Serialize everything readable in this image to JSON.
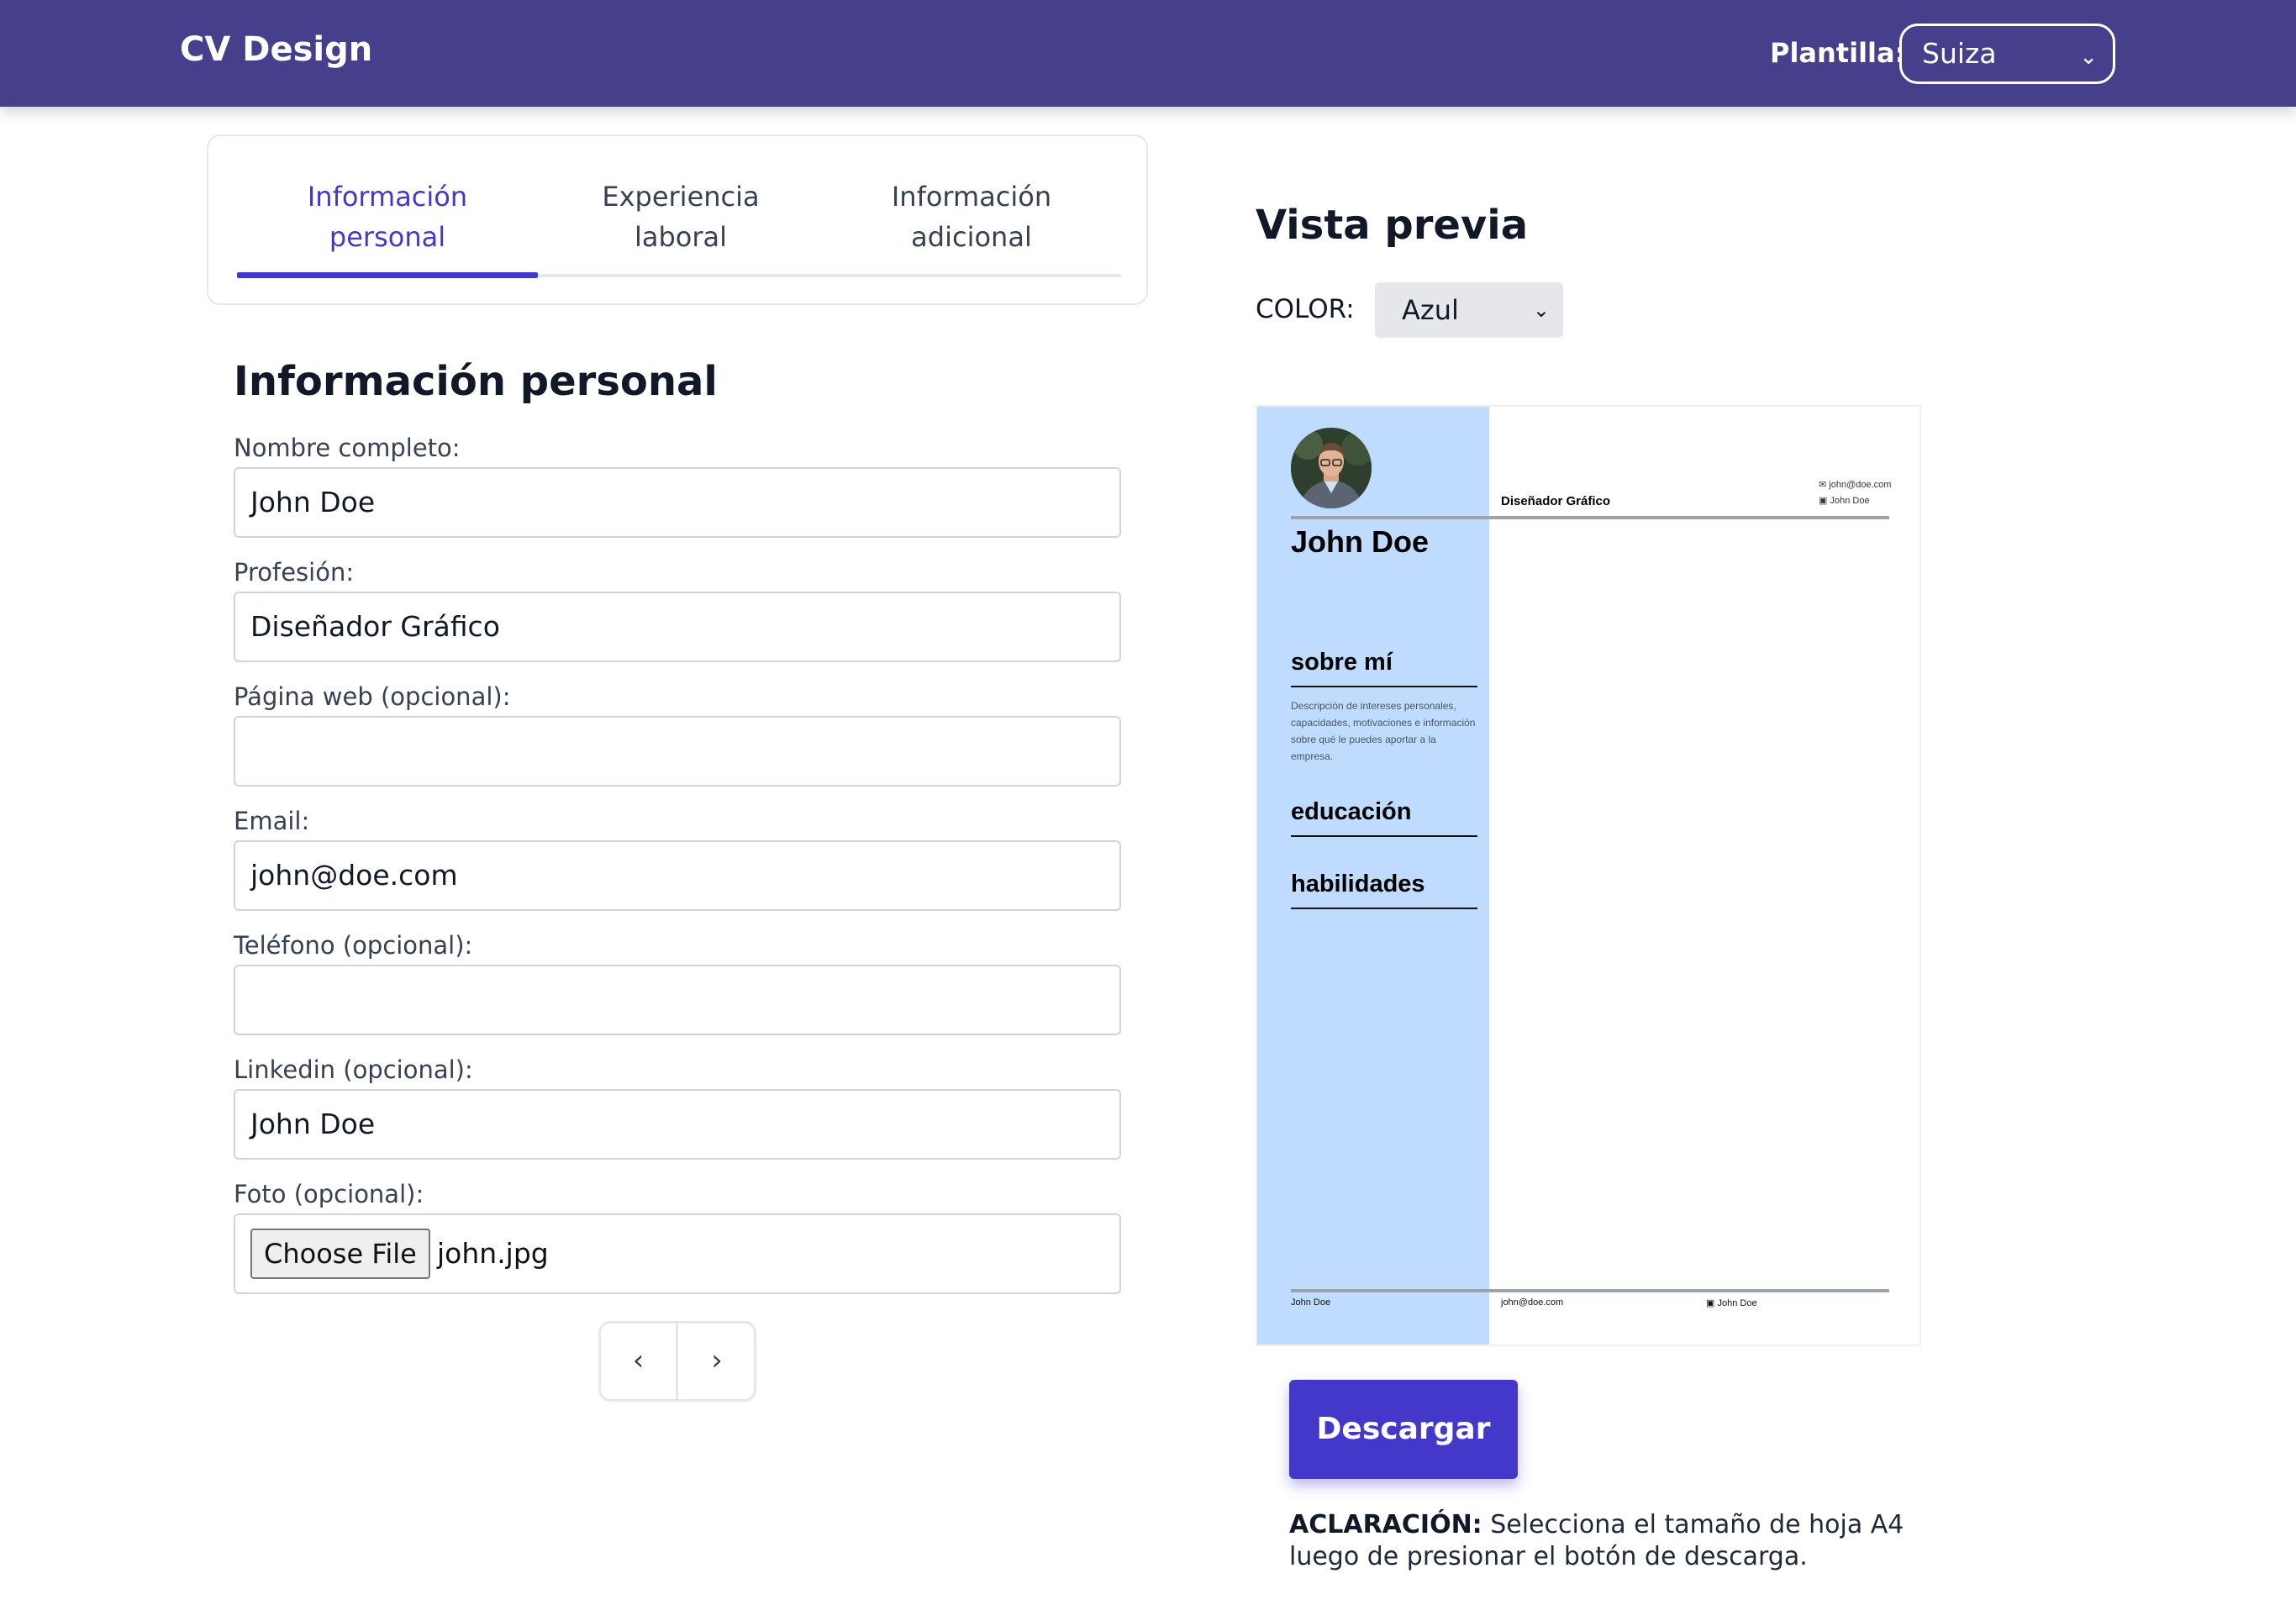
{
  "header": {
    "brand": "CV Design",
    "template_label": "Plantilla:",
    "template_value": "Suiza"
  },
  "tabs": [
    {
      "line1": "Información",
      "line2": "personal",
      "active": true
    },
    {
      "line1": "Experiencia",
      "line2": "laboral",
      "active": false
    },
    {
      "line1": "Información",
      "line2": "adicional",
      "active": false
    }
  ],
  "form": {
    "title": "Información personal",
    "fields": {
      "name": {
        "label": "Nombre completo:",
        "value": "John Doe"
      },
      "profession": {
        "label": "Profesión:",
        "value": "Diseñador Gráfico"
      },
      "website": {
        "label": "Página web (opcional):",
        "value": ""
      },
      "email": {
        "label": "Email:",
        "value": "john@doe.com"
      },
      "phone": {
        "label": "Teléfono (opcional):",
        "value": ""
      },
      "linkedin": {
        "label": "Linkedin (opcional):",
        "value": "John Doe"
      },
      "photo": {
        "label": "Foto (opcional):",
        "button": "Choose File",
        "file": "john.jpg"
      }
    },
    "pager": {
      "prev": "‹",
      "next": "›"
    }
  },
  "preview": {
    "title": "Vista previa",
    "color_label": "COLOR:",
    "color_value": "Azul",
    "cv": {
      "name": "John Doe",
      "profession": "Diseñador Gráfico",
      "email": "john@doe.com",
      "linkedin": "John Doe",
      "sections": {
        "about": "sobre mí",
        "education": "educación",
        "skills": "habilidades"
      },
      "about_text": "Descripción de intereses personales, capacidades, motivaciones e información sobre qué le puedes aportar a la empresa.",
      "footer": {
        "name": "John Doe",
        "email": "john@doe.com",
        "linkedin": "John Doe"
      }
    },
    "download": "Descargar",
    "note_strong": "ACLARACIÓN:",
    "note_text": " Selecciona el tamaño de hoja A4 luego de presionar el botón de descarga."
  },
  "colors": {
    "navbar": "#46408c",
    "accent": "#4338ca",
    "cv_sidebar": "#bfdbfe"
  }
}
